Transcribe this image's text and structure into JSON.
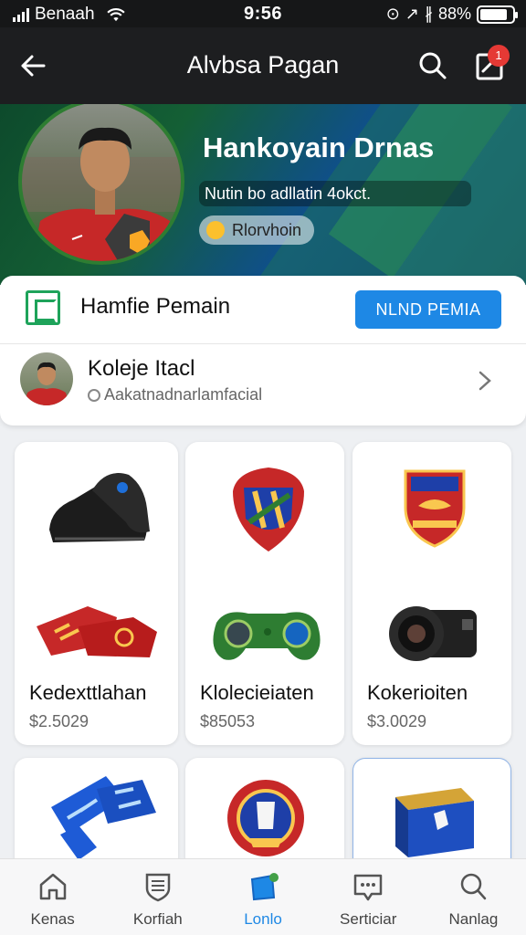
{
  "status_bar": {
    "carrier": "Benaah",
    "time": "9:56",
    "battery": "88%",
    "battery_level": 0.88
  },
  "app_bar": {
    "title": "Alvbsa Pagan",
    "notification_count": "1"
  },
  "hero": {
    "name": "Hankoyain Drnas",
    "subtitle": "Nutin bo adllatin 4okct.",
    "chip": "Rlorvhoin"
  },
  "profile_card": {
    "title": "Hamfie Pemain",
    "button_label": "NLND PEMIA",
    "row_name": "Koleje Itacl",
    "row_sub": "Aakatnadnarlamfacial"
  },
  "items": [
    {
      "label": "Kedexttlahan",
      "price": "$2.5029"
    },
    {
      "label": "Klolecieiaten",
      "price": "$85053"
    },
    {
      "label": "Kokerioiten",
      "price": "$3.0029"
    }
  ],
  "bottom_nav": [
    {
      "label": "Kenas",
      "icon": "home-icon"
    },
    {
      "label": "Korfiah",
      "icon": "shield-icon"
    },
    {
      "label": "Lonlo",
      "icon": "collection-icon"
    },
    {
      "label": "Serticiar",
      "icon": "chat-icon"
    },
    {
      "label": "Nanlag",
      "icon": "search-icon"
    }
  ],
  "colors": {
    "accent": "#1e88e5",
    "badge": "#e53935",
    "brand_green": "#1ea35a"
  }
}
